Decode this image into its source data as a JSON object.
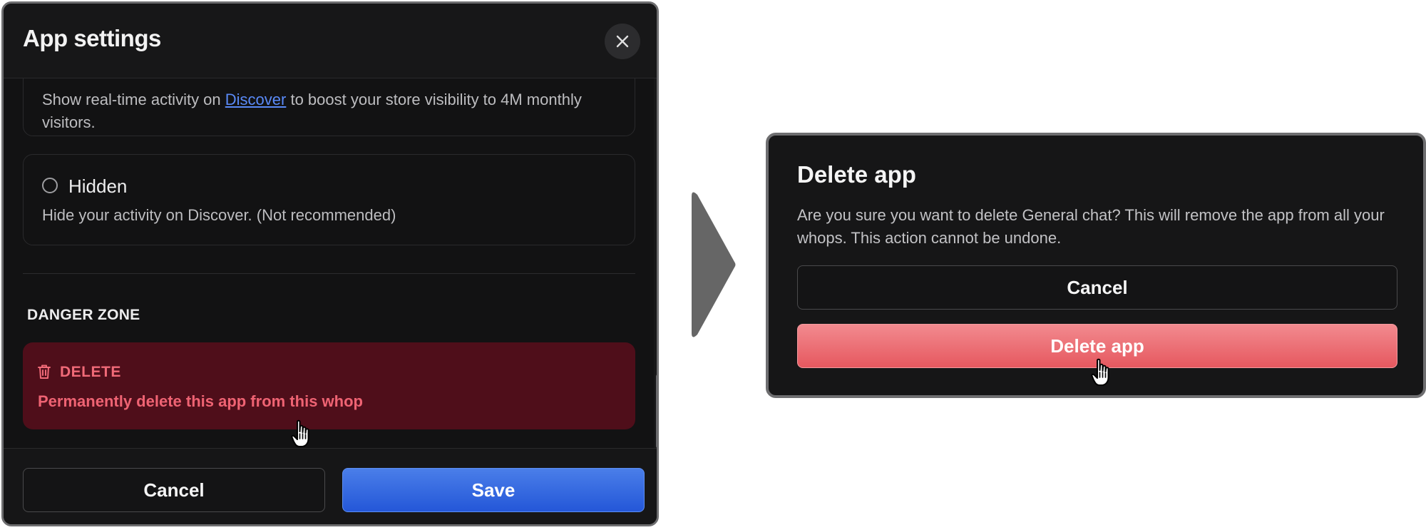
{
  "app_settings": {
    "title": "App settings",
    "visibility_option": {
      "desc_before": "Show real-time activity on ",
      "desc_link": "Discover",
      "desc_after": " to boost your store visibility to 4M monthly visitors."
    },
    "hidden_option": {
      "label": "Hidden",
      "description": "Hide your activity on Discover. (Not recommended)"
    },
    "danger_zone": {
      "heading": "DANGER ZONE",
      "delete_title": "DELETE",
      "delete_description": "Permanently delete this app from this whop"
    },
    "footer": {
      "cancel_label": "Cancel",
      "save_label": "Save"
    }
  },
  "delete_dialog": {
    "title": "Delete app",
    "message": "Are you sure you want to delete General chat? This will remove the app from all your whops. This action cannot be undone.",
    "cancel_label": "Cancel",
    "confirm_label": "Delete app"
  },
  "colors": {
    "danger_bg": "#4f0e1a",
    "danger_text": "#f06a78",
    "primary_blue": "#2d63e0",
    "delete_red": "#ec6b71"
  },
  "icons": [
    "close-icon",
    "trash-icon",
    "hand-pointer-icon",
    "arrow-right-icon"
  ]
}
